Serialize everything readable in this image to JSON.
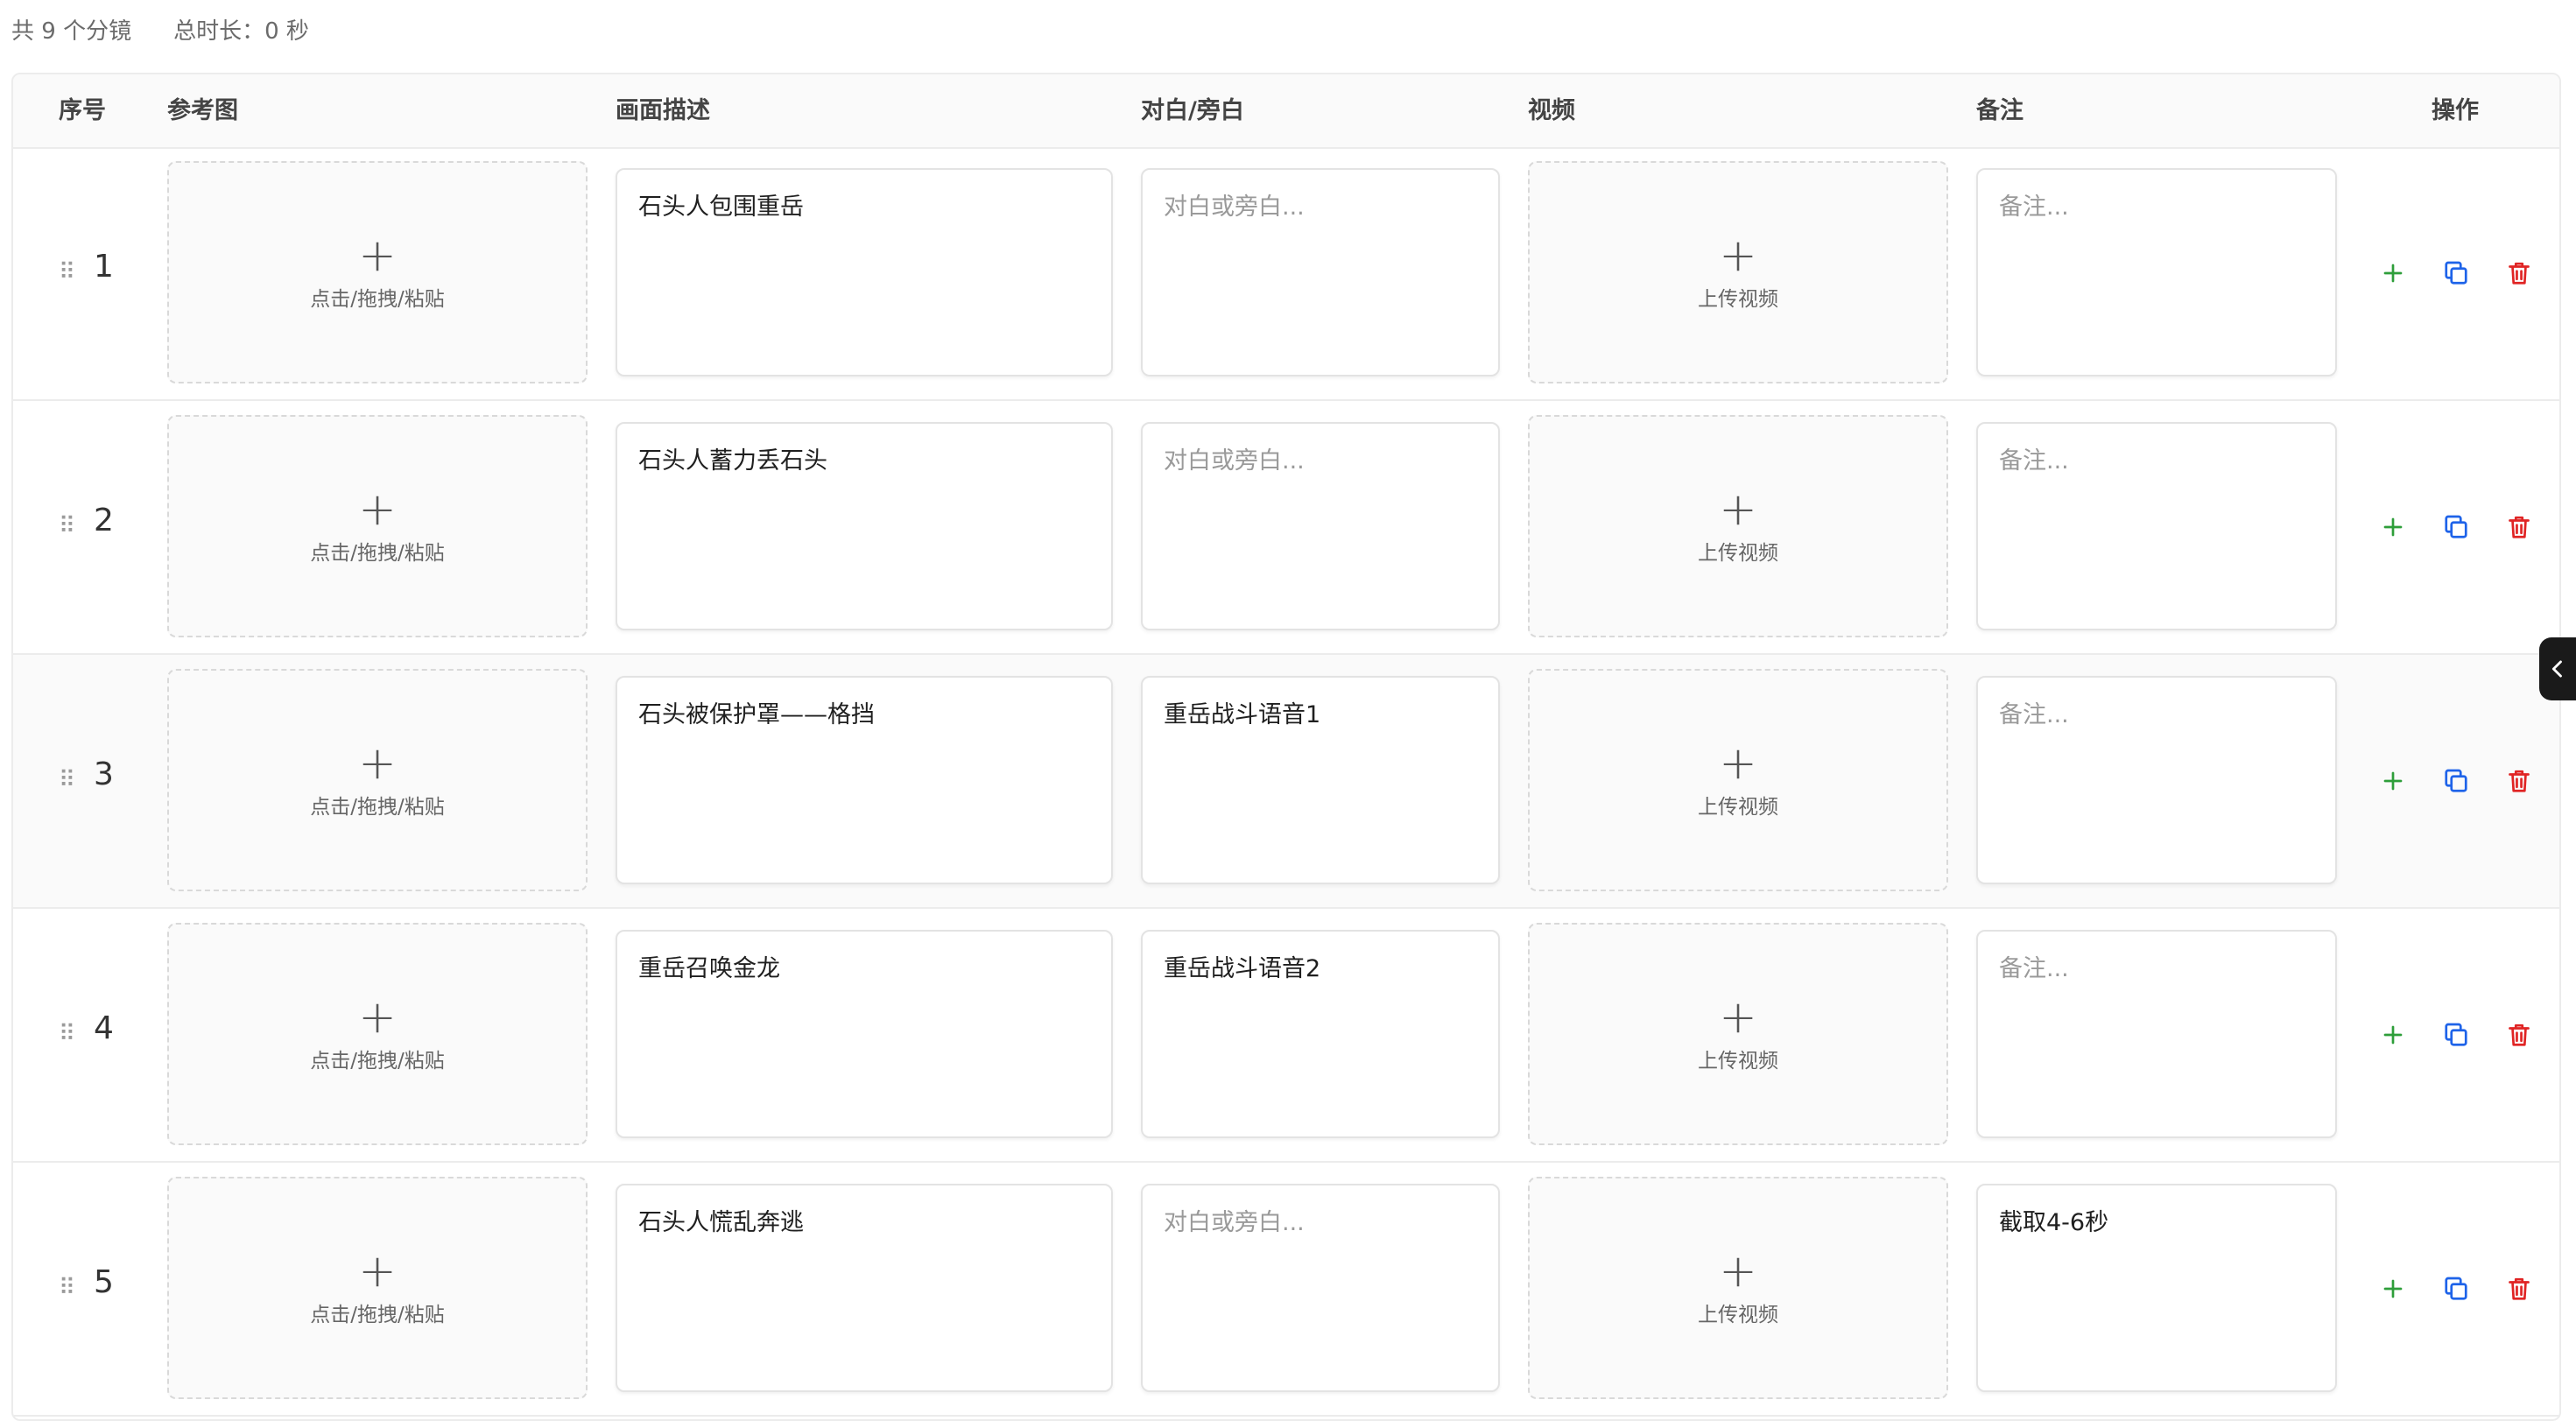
{
  "summary": {
    "count_text": "共 9 个分镜",
    "duration_text": "总时长：0 秒"
  },
  "table": {
    "headers": {
      "index": "序号",
      "reference": "参考图",
      "description": "画面描述",
      "dialogue": "对白/旁白",
      "video": "视频",
      "notes": "备注",
      "actions": "操作"
    },
    "upload_image_label": "点击/拖拽/粘贴",
    "upload_video_label": "上传视频",
    "rows": [
      {
        "index": "1",
        "description": "石头人包围重岳",
        "dialogue": "对白或旁白...",
        "dialogue_is_placeholder": true,
        "notes": "备注...",
        "notes_is_placeholder": true
      },
      {
        "index": "2",
        "description": "石头人蓄力丢石头",
        "dialogue": "对白或旁白...",
        "dialogue_is_placeholder": true,
        "notes": "备注...",
        "notes_is_placeholder": true
      },
      {
        "index": "3",
        "description": "石头被保护罩——格挡",
        "dialogue": "重岳战斗语音1",
        "dialogue_is_placeholder": false,
        "notes": "备注...",
        "notes_is_placeholder": true
      },
      {
        "index": "4",
        "description": "重岳召唤金龙",
        "dialogue": "重岳战斗语音2",
        "dialogue_is_placeholder": false,
        "notes": "备注...",
        "notes_is_placeholder": true
      },
      {
        "index": "5",
        "description": "石头人慌乱奔逃",
        "dialogue": "对白或旁白...",
        "dialogue_is_placeholder": true,
        "notes": "截取4-6秒",
        "notes_is_placeholder": false
      }
    ]
  },
  "icons": {
    "drag": "drag-handle-icon",
    "add": "plus-icon",
    "copy": "copy-icon",
    "delete": "trash-icon",
    "side_toggle": "chevron-left-icon"
  },
  "colors": {
    "add": "#2e9e3a",
    "copy": "#1e63e9",
    "delete": "#e02424"
  }
}
